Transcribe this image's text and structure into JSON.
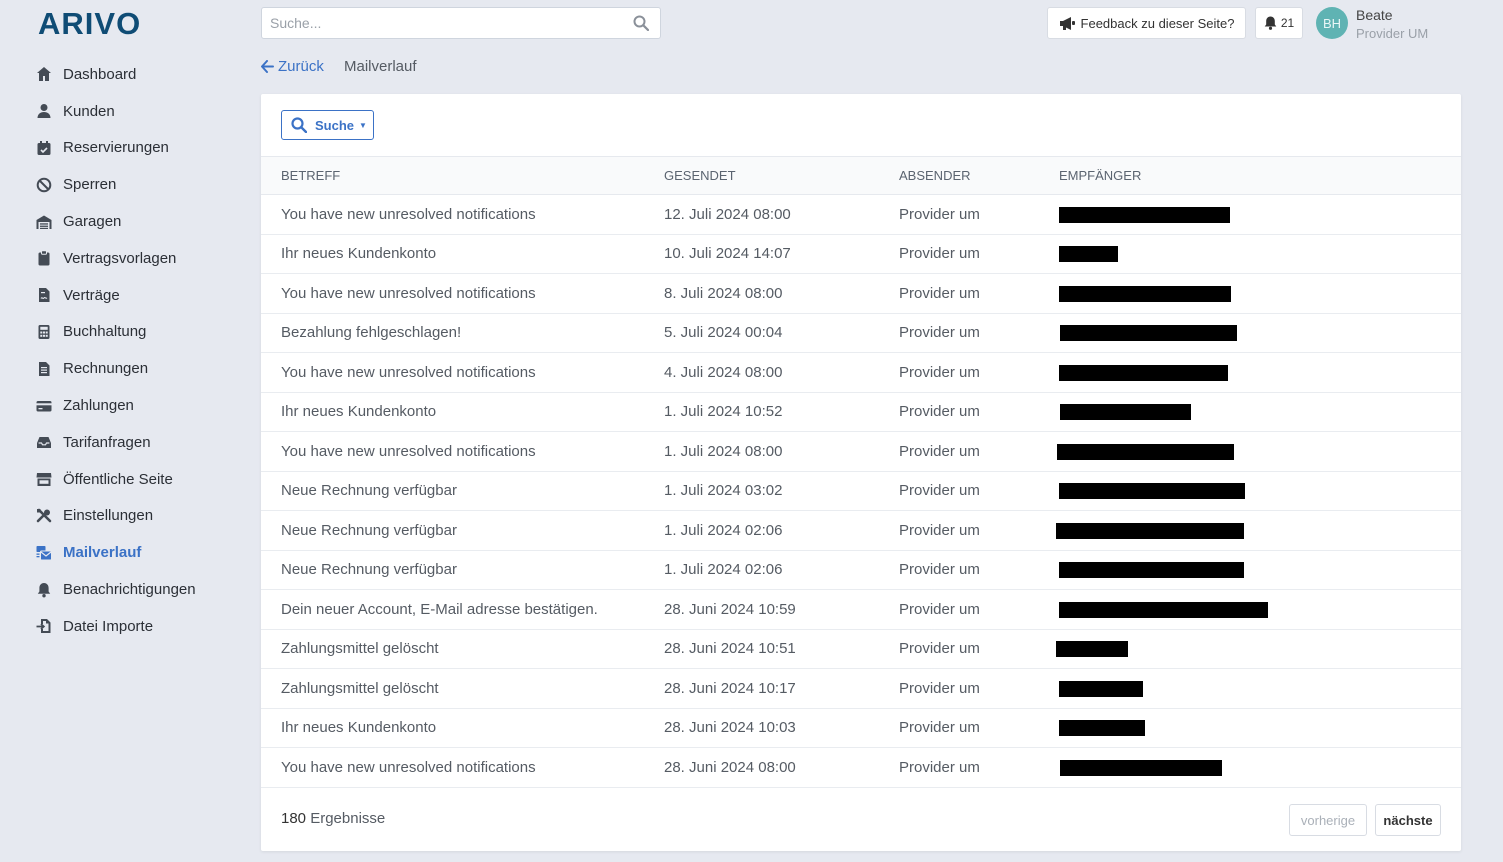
{
  "brand": {
    "logo_text": "ARIVO",
    "color": "#0f4c75"
  },
  "search": {
    "placeholder": "Suche..."
  },
  "header": {
    "feedback_label": "Feedback zu dieser Seite?",
    "notifications_count": "21",
    "user": {
      "initials": "BH",
      "name": "Beate",
      "role": "Provider UM"
    }
  },
  "sidebar": {
    "items": [
      {
        "label": "Dashboard",
        "icon": "home-icon"
      },
      {
        "label": "Kunden",
        "icon": "user-icon"
      },
      {
        "label": "Reservierungen",
        "icon": "calendar-check-icon"
      },
      {
        "label": "Sperren",
        "icon": "ban-icon"
      },
      {
        "label": "Garagen",
        "icon": "garage-icon"
      },
      {
        "label": "Vertragsvorlagen",
        "icon": "clipboard-icon"
      },
      {
        "label": "Verträge",
        "icon": "file-contract-icon"
      },
      {
        "label": "Buchhaltung",
        "icon": "calculator-icon"
      },
      {
        "label": "Rechnungen",
        "icon": "invoice-icon"
      },
      {
        "label": "Zahlungen",
        "icon": "credit-card-icon"
      },
      {
        "label": "Tarifanfragen",
        "icon": "inbox-icon"
      },
      {
        "label": "Öffentliche Seite",
        "icon": "store-icon"
      },
      {
        "label": "Einstellungen",
        "icon": "tools-icon"
      },
      {
        "label": "Mailverlauf",
        "icon": "mail-bulk-icon",
        "active": true
      },
      {
        "label": "Benachrichtigungen",
        "icon": "bell-icon"
      },
      {
        "label": "Datei Importe",
        "icon": "file-import-icon"
      }
    ]
  },
  "breadcrumb": {
    "back_label": "Zurück",
    "current": "Mailverlauf"
  },
  "filter": {
    "label": "Suche"
  },
  "table": {
    "columns": [
      "BETREFF",
      "GESENDET",
      "ABSENDER",
      "EMPFÄNGER"
    ],
    "rows": [
      {
        "subject": "You have new unresolved notifications",
        "sent": "12. Juli 2024 08:00",
        "sender": "Provider um",
        "recipient_redacted": true
      },
      {
        "subject": "Ihr neues Kundenkonto",
        "sent": "10. Juli 2024 14:07",
        "sender": "Provider um",
        "recipient_redacted": true
      },
      {
        "subject": "You have new unresolved notifications",
        "sent": "8. Juli 2024 08:00",
        "sender": "Provider um",
        "recipient_redacted": true
      },
      {
        "subject": "Bezahlung fehlgeschlagen!",
        "sent": "5. Juli 2024 00:04",
        "sender": "Provider um",
        "recipient_redacted": true
      },
      {
        "subject": "You have new unresolved notifications",
        "sent": "4. Juli 2024 08:00",
        "sender": "Provider um",
        "recipient_redacted": true
      },
      {
        "subject": "Ihr neues Kundenkonto",
        "sent": "1. Juli 2024 10:52",
        "sender": "Provider um",
        "recipient_redacted": true
      },
      {
        "subject": "You have new unresolved notifications",
        "sent": "1. Juli 2024 08:00",
        "sender": "Provider um",
        "recipient_redacted": true
      },
      {
        "subject": "Neue Rechnung verfügbar",
        "sent": "1. Juli 2024 03:02",
        "sender": "Provider um",
        "recipient_redacted": true
      },
      {
        "subject": "Neue Rechnung verfügbar",
        "sent": "1. Juli 2024 02:06",
        "sender": "Provider um",
        "recipient_redacted": true
      },
      {
        "subject": "Neue Rechnung verfügbar",
        "sent": "1. Juli 2024 02:06",
        "sender": "Provider um",
        "recipient_redacted": true
      },
      {
        "subject": "Dein neuer Account, E-Mail adresse bestätigen.",
        "sent": "28. Juni 2024 10:59",
        "sender": "Provider um",
        "recipient_redacted": true
      },
      {
        "subject": "Zahlungsmittel gelöscht",
        "sent": "28. Juni 2024 10:51",
        "sender": "Provider um",
        "recipient_redacted": true
      },
      {
        "subject": "Zahlungsmittel gelöscht",
        "sent": "28. Juni 2024 10:17",
        "sender": "Provider um",
        "recipient_redacted": true
      },
      {
        "subject": "Ihr neues Kundenkonto",
        "sent": "28. Juni 2024 10:03",
        "sender": "Provider um",
        "recipient_redacted": true
      },
      {
        "subject": "You have new unresolved notifications",
        "sent": "28. Juni 2024 08:00",
        "sender": "Provider um",
        "recipient_redacted": true
      }
    ]
  },
  "footer": {
    "result_count": "180",
    "result_label": "Ergebnisse",
    "prev_label": "vorherige",
    "next_label": "nächste"
  },
  "colors": {
    "accent": "#3b72c6",
    "background": "#e6e9f0",
    "avatar": "#5fb3b3"
  }
}
